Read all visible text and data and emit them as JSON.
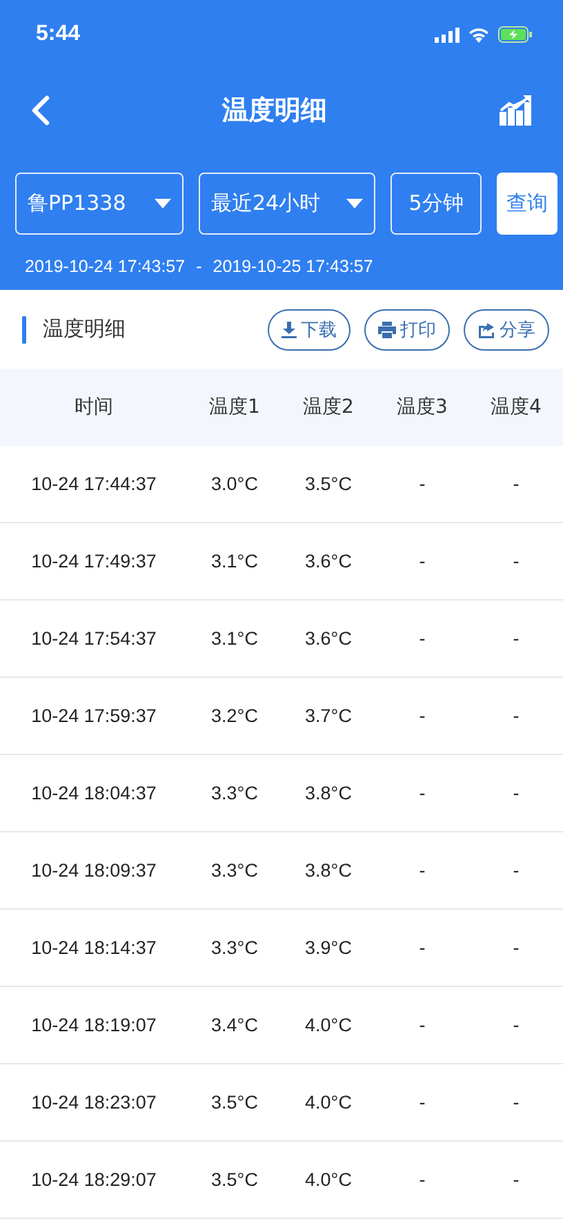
{
  "status_bar": {
    "time": "5:44"
  },
  "nav": {
    "title": "温度明细"
  },
  "filters": {
    "vehicle": "鲁PP1338",
    "range": "最近24小时",
    "interval": "5分钟",
    "query_button": "查询"
  },
  "date_range": {
    "start": "2019-10-24 17:43:57",
    "separator": "-",
    "end": "2019-10-25 17:43:57"
  },
  "section": {
    "title": "温度明细",
    "actions": [
      {
        "kind": "download",
        "label": "下载"
      },
      {
        "kind": "print",
        "label": "打印"
      },
      {
        "kind": "share",
        "label": "分享"
      }
    ]
  },
  "table": {
    "columns": [
      "时间",
      "温度1",
      "温度2",
      "温度3",
      "温度4"
    ],
    "rows": [
      [
        "10-24 17:44:37",
        "3.0°C",
        "3.5°C",
        "-",
        "-"
      ],
      [
        "10-24 17:49:37",
        "3.1°C",
        "3.6°C",
        "-",
        "-"
      ],
      [
        "10-24 17:54:37",
        "3.1°C",
        "3.6°C",
        "-",
        "-"
      ],
      [
        "10-24 17:59:37",
        "3.2°C",
        "3.7°C",
        "-",
        "-"
      ],
      [
        "10-24 18:04:37",
        "3.3°C",
        "3.8°C",
        "-",
        "-"
      ],
      [
        "10-24 18:09:37",
        "3.3°C",
        "3.8°C",
        "-",
        "-"
      ],
      [
        "10-24 18:14:37",
        "3.3°C",
        "3.9°C",
        "-",
        "-"
      ],
      [
        "10-24 18:19:07",
        "3.4°C",
        "4.0°C",
        "-",
        "-"
      ],
      [
        "10-24 18:23:07",
        "3.5°C",
        "4.0°C",
        "-",
        "-"
      ],
      [
        "10-24 18:29:07",
        "3.5°C",
        "4.0°C",
        "-",
        "-"
      ]
    ]
  }
}
